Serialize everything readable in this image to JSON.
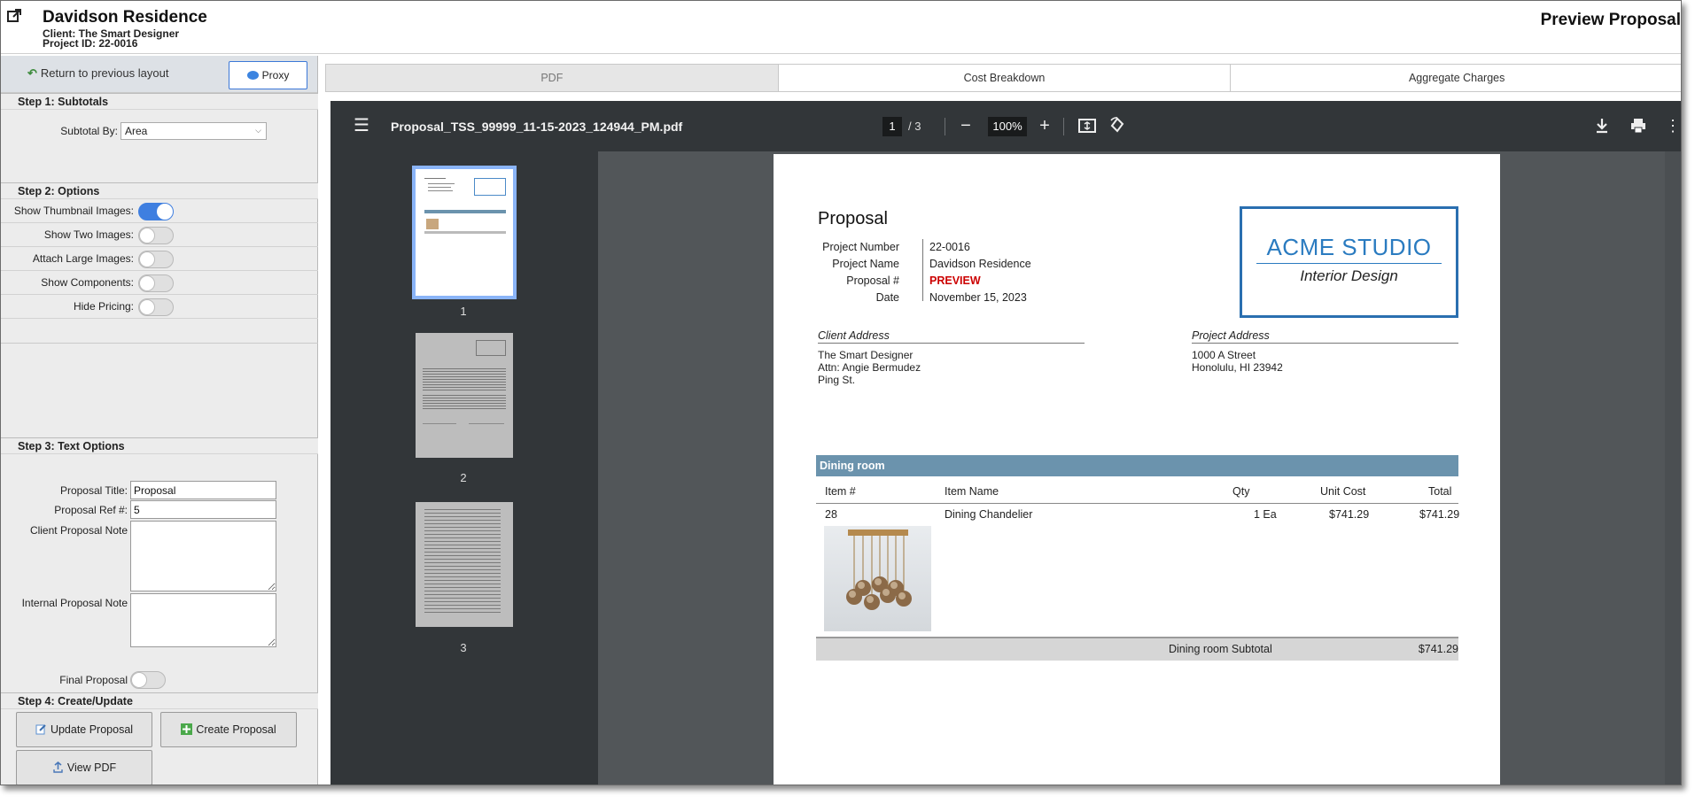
{
  "header": {
    "project_title": "Davidson Residence",
    "client_line": "Client: The Smart Designer",
    "project_id_line": "Project ID: 22-0016",
    "page_title": "Preview Proposal"
  },
  "left_panel": {
    "return_label": "Return to previous layout",
    "proxy_label": "Proxy",
    "step1": {
      "heading": "Step 1: Subtotals",
      "subtotal_label": "Subtotal By:",
      "subtotal_value": "Area"
    },
    "step2": {
      "heading": "Step 2: Options",
      "options": [
        {
          "label": "Show Thumbnail Images:",
          "on": true
        },
        {
          "label": "Show Two Images:",
          "on": false
        },
        {
          "label": "Attach Large Images:",
          "on": false
        },
        {
          "label": "Show Components:",
          "on": false
        },
        {
          "label": "Hide Pricing:",
          "on": false
        }
      ]
    },
    "step3": {
      "heading": "Step 3: Text Options",
      "title_label": "Proposal Title:",
      "title_value": "Proposal",
      "ref_label": "Proposal Ref #:",
      "ref_value": "5",
      "client_note_label": "Client Proposal Note",
      "internal_note_label": "Internal Proposal Note",
      "final_label": "Final Proposal",
      "final_on": false
    },
    "step4": {
      "heading": "Step 4: Create/Update",
      "update_label": "Update Proposal",
      "create_label": "Create Proposal",
      "view_label": "View PDF"
    }
  },
  "tabs": [
    {
      "label": "PDF",
      "active": true
    },
    {
      "label": "Cost Breakdown",
      "active": false
    },
    {
      "label": "Aggregate Charges",
      "active": false
    }
  ],
  "viewer": {
    "file_name": "Proposal_TSS_99999_11-15-2023_124944_PM.pdf",
    "current_page": "1",
    "total_pages": "/  3",
    "zoom": "100%",
    "thumbnails": [
      "1",
      "2",
      "3"
    ]
  },
  "document": {
    "title": "Proposal",
    "fields": [
      {
        "key": "Project Number",
        "value": "22-0016"
      },
      {
        "key": "Project Name",
        "value": "Davidson Residence"
      },
      {
        "key": "Proposal #",
        "value": "PREVIEW"
      },
      {
        "key": "Date",
        "value": "November 15, 2023"
      }
    ],
    "logo_title": "ACME STUDIO",
    "logo_subtitle": "Interior Design",
    "client_address_heading": "Client Address",
    "client_address": [
      "The Smart Designer",
      "Attn: Angie Bermudez",
      "Ping St."
    ],
    "project_address_heading": "Project Address",
    "project_address": [
      "1000 A Street",
      "Honolulu, HI 23942"
    ],
    "section_name": "Dining room",
    "columns": [
      "Item #",
      "Item Name",
      "Qty",
      "Unit Cost",
      "Total"
    ],
    "item": {
      "number": "28",
      "name": "Dining Chandelier",
      "qty": "1 Ea",
      "unit_cost": "$741.29",
      "total": "$741.29"
    },
    "subtotal_label": "Dining room Subtotal",
    "subtotal_value": "$741.29"
  },
  "colors": {
    "accent_blue": "#3f7fe0",
    "logo_blue": "#2a7bc0",
    "section_bar": "#6b93ad",
    "preview_red": "#cc0000"
  }
}
